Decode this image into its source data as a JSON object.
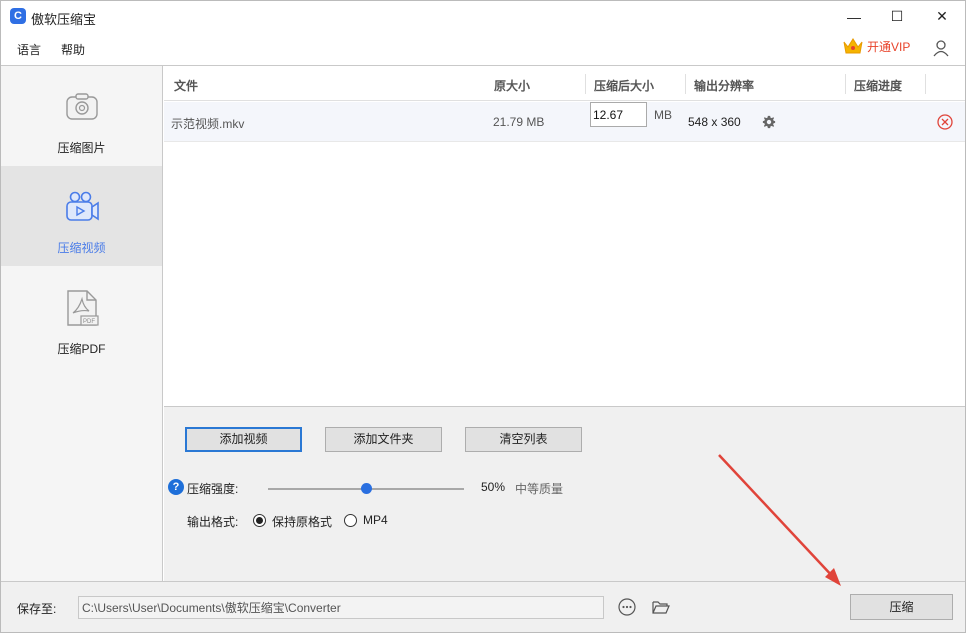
{
  "window": {
    "title": "傲软压缩宝",
    "app_icon_glyph": "C",
    "minimize_glyph": "—",
    "maximize_glyph": "☐",
    "close_glyph": "✕"
  },
  "menu": {
    "items": [
      "语言",
      "帮助"
    ],
    "vip_label": "开通VIP"
  },
  "sidebar": {
    "items": [
      {
        "label": "压缩图片",
        "icon": "camera-icon",
        "active": false
      },
      {
        "label": "压缩视频",
        "icon": "video-camera-icon",
        "active": true
      },
      {
        "label": "压缩PDF",
        "icon": "pdf-file-icon",
        "active": false
      }
    ]
  },
  "table": {
    "columns": [
      "文件",
      "原大小",
      "压缩后大小",
      "输出分辨率",
      "压缩进度"
    ],
    "rows": [
      {
        "file": "示范视频.mkv",
        "original_size": "21.79 MB",
        "target_size": "12.67",
        "target_unit": "MB",
        "resolution": "548 x 360",
        "progress": ""
      }
    ]
  },
  "controls": {
    "add_video": "添加视频",
    "add_folder": "添加文件夹",
    "clear_list": "清空列表",
    "strength_label": "压缩强度:",
    "strength_value": 0.5,
    "strength_percent": "50%",
    "quality_label": "中等质量",
    "help_glyph": "?",
    "format_label": "输出格式:",
    "format_options": [
      "保持原格式",
      "MP4"
    ],
    "format_selected": "保持原格式"
  },
  "footer": {
    "save_label": "保存至:",
    "save_path": "C:\\Users\\User\\Documents\\傲软压缩宝\\Converter",
    "compress_button": "压缩"
  },
  "colors": {
    "accent": "#2a78d4",
    "active_sidebar_text": "#4a7ce8",
    "vip": "#e8432a",
    "remove_icon": "#e0443a",
    "annotation_arrow": "#e0443a"
  }
}
